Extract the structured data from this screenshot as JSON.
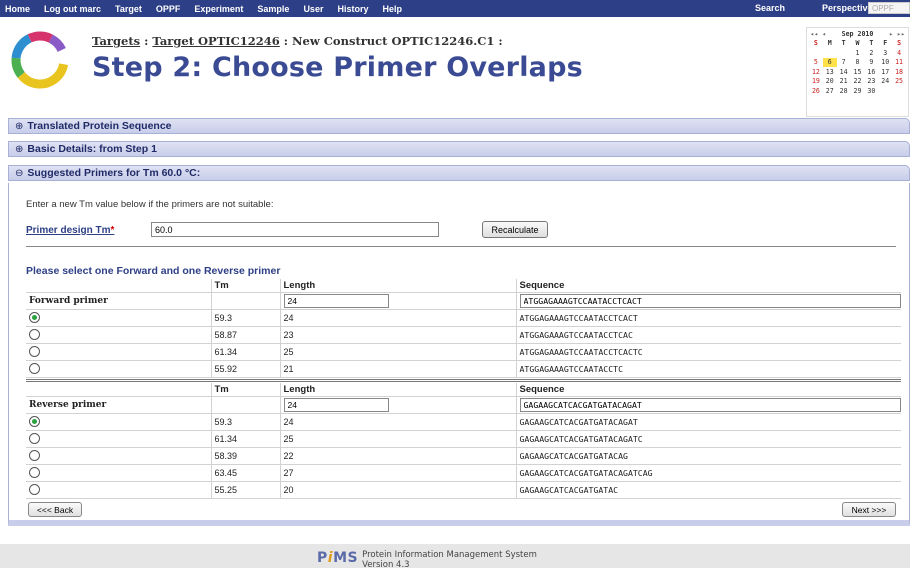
{
  "menu": {
    "items": [
      "Home",
      "Log out marc",
      "Target",
      "OPPF",
      "Experiment",
      "Sample",
      "User",
      "History",
      "Help"
    ],
    "search_label": "Search",
    "perspective_label": "Perspective:",
    "perspective_value": "OPPF"
  },
  "header": {
    "crumb_targets": "Targets",
    "crumb_sep": " : ",
    "crumb_target": "Target OPTIC12246",
    "crumb_rest": " : New Construct OPTIC12246.C1 :",
    "title": "Step 2: Choose Primer Overlaps"
  },
  "calendar": {
    "month": "Sep 2010",
    "nav_prev": "◂◂ ◂",
    "nav_next": "▸ ▸▸",
    "dow": [
      "S",
      "M",
      "T",
      "W",
      "T",
      "F",
      "S"
    ],
    "weeks": [
      [
        "",
        "",
        "",
        "1",
        "2",
        "3",
        "4"
      ],
      [
        "5",
        "6",
        "7",
        "8",
        "9",
        "10",
        "11"
      ],
      [
        "12",
        "13",
        "14",
        "15",
        "16",
        "17",
        "18"
      ],
      [
        "19",
        "20",
        "21",
        "22",
        "23",
        "24",
        "25"
      ],
      [
        "26",
        "27",
        "28",
        "29",
        "30",
        "",
        ""
      ]
    ],
    "today": "6"
  },
  "sections": {
    "translated": "Translated Protein Sequence",
    "basic": "Basic Details: from Step 1",
    "suggested": "Suggested Primers for Tm 60.0 °C:",
    "toggle_closed": "⊕",
    "toggle_open": "⊖"
  },
  "form": {
    "intro": "Enter a new Tm value below if the primers are not suitable:",
    "tm_label": "Primer design Tm",
    "tm_required": "*",
    "tm_value": "60.0",
    "recalculate": "Recalculate",
    "select_heading": "Please select one Forward and one Reverse primer"
  },
  "columns": {
    "tm": "Tm",
    "length": "Length",
    "sequence": "Sequence"
  },
  "forward": {
    "label": "Forward primer",
    "length_value": "24",
    "sequence_value": "ATGGAGAAAGTCCAATACCTCACT",
    "selected": 0,
    "rows": [
      {
        "tm": "59.3",
        "length": "24",
        "sequence": "ATGGAGAAAGTCCAATACCTCACT"
      },
      {
        "tm": "58.87",
        "length": "23",
        "sequence": "ATGGAGAAAGTCCAATACCTCAC"
      },
      {
        "tm": "61.34",
        "length": "25",
        "sequence": "ATGGAGAAAGTCCAATACCTCACTC"
      },
      {
        "tm": "55.92",
        "length": "21",
        "sequence": "ATGGAGAAAGTCCAATACCTC"
      }
    ]
  },
  "reverse": {
    "label": "Reverse primer",
    "length_value": "24",
    "sequence_value": "GAGAAGCATCACGATGATACAGAT",
    "selected": 0,
    "rows": [
      {
        "tm": "59.3",
        "length": "24",
        "sequence": "GAGAAGCATCACGATGATACAGAT"
      },
      {
        "tm": "61.34",
        "length": "25",
        "sequence": "GAGAAGCATCACGATGATACAGATC"
      },
      {
        "tm": "58.39",
        "length": "22",
        "sequence": "GAGAAGCATCACGATGATACAG"
      },
      {
        "tm": "63.45",
        "length": "27",
        "sequence": "GAGAAGCATCACGATGATACAGATCAG"
      },
      {
        "tm": "55.25",
        "length": "20",
        "sequence": "GAGAAGCATCACGATGATAC"
      }
    ]
  },
  "buttons": {
    "back": "<<< Back",
    "next": "Next >>>"
  },
  "footer": {
    "logo_p": "P",
    "logo_i": "i",
    "logo_ms": "MS",
    "line1": "Protein Information Management System",
    "line2": "Version 4.3"
  },
  "colors": {
    "menubar": "#2d3f86",
    "title": "#3a4b94",
    "section": "#c8cdea",
    "radio_selected": "#2aa040"
  }
}
